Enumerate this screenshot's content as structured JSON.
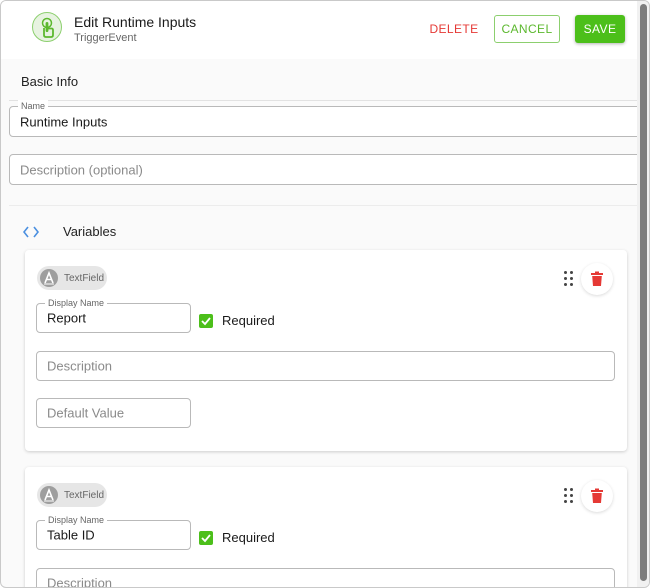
{
  "header": {
    "title": "Edit Runtime Inputs",
    "subtitle": "TriggerEvent",
    "delete_label": "DELETE",
    "cancel_label": "CANCEL",
    "save_label": "SAVE",
    "icon": "touch-trigger-icon"
  },
  "basic_info": {
    "title": "Basic Info",
    "name_label": "Name",
    "name_value": "Runtime Inputs",
    "description_placeholder": "Description (optional)"
  },
  "variables": {
    "title": "Variables",
    "items": [
      {
        "type_label": "TextField",
        "display_name_label": "Display Name",
        "display_name_value": "Report",
        "required_label": "Required",
        "required_checked": true,
        "description_placeholder": "Description",
        "default_value_placeholder": "Default Value"
      },
      {
        "type_label": "TextField",
        "display_name_label": "Display Name",
        "display_name_value": "Table ID",
        "required_label": "Required",
        "required_checked": true,
        "description_placeholder": "Description"
      }
    ]
  },
  "colors": {
    "accent_green": "#4cbf1a",
    "delete_red": "#e53935"
  }
}
